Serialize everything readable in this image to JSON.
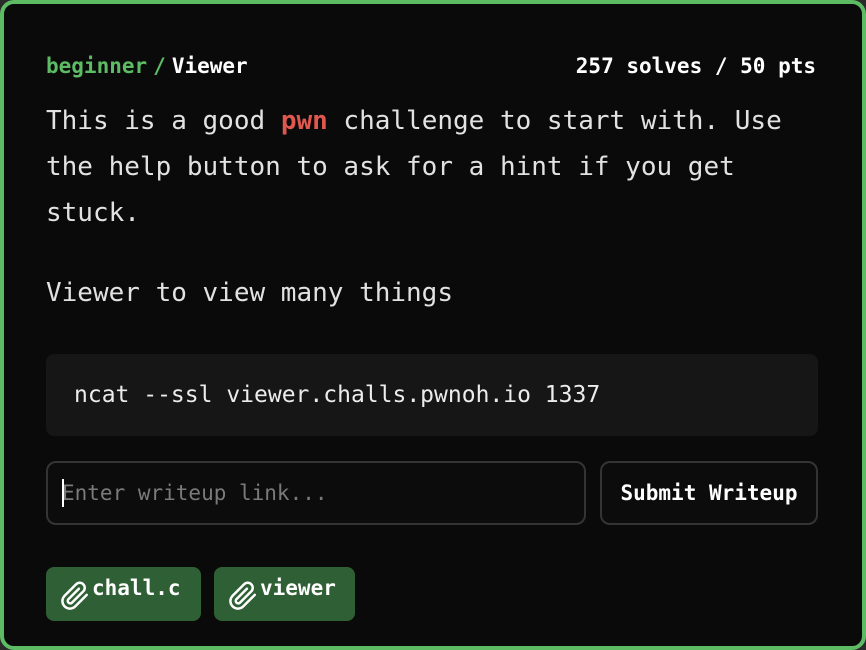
{
  "challenge": {
    "category": "beginner",
    "separator": "/",
    "name": "Viewer",
    "stats": "257 solves / 50 pts"
  },
  "description": {
    "part1": "This is a good ",
    "highlight": "pwn",
    "part2": " challenge to start with. Use the help button to ask for a hint if you get stuck.",
    "subtitle": "Viewer to view many things"
  },
  "connection": {
    "command": "ncat --ssl viewer.challs.pwnoh.io 1337"
  },
  "writeup": {
    "placeholder": "Enter writeup link...",
    "value": "",
    "submit_label": "Submit Writeup"
  },
  "files": [
    {
      "name": "chall.c",
      "icon": "paperclip-icon"
    },
    {
      "name": "viewer",
      "icon": "paperclip-icon"
    }
  ],
  "colors": {
    "accent": "#5dbb63",
    "highlight": "#e0574f",
    "file_chip": "#2f5f34",
    "background": "#0a0a0a"
  }
}
